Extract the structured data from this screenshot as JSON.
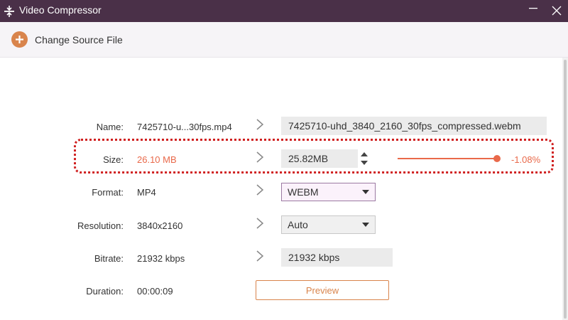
{
  "window": {
    "title": "Video Compressor"
  },
  "toolbar": {
    "change_source_label": "Change Source File"
  },
  "colors": {
    "titlebar": "#4a3048",
    "accent": "#d9844c",
    "slider": "#e9694a",
    "highlight": "#d02020"
  },
  "fields": {
    "name": {
      "label": "Name:",
      "source": "7425710-u...30fps.mp4",
      "output": "7425710-uhd_3840_2160_30fps_compressed.webm"
    },
    "size": {
      "label": "Size:",
      "source": "26.10 MB",
      "output": "25.82MB",
      "percent": "-1.08%",
      "slider_fraction": 0.99
    },
    "format": {
      "label": "Format:",
      "source": "MP4",
      "selected": "WEBM"
    },
    "resolution": {
      "label": "Resolution:",
      "source": "3840x2160",
      "selected": "Auto"
    },
    "bitrate": {
      "label": "Bitrate:",
      "source": "21932 kbps",
      "output": "21932 kbps"
    },
    "duration": {
      "label": "Duration:",
      "source": "00:00:09"
    }
  },
  "preview_label": "Preview"
}
